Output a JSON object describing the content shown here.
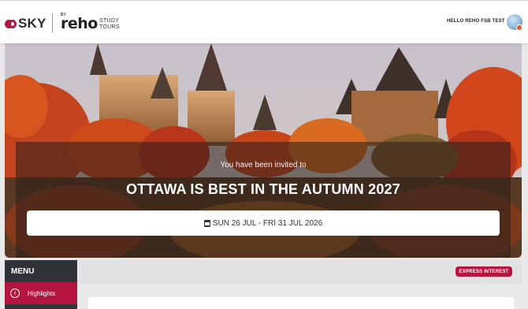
{
  "header": {
    "brand_sky": "SKY",
    "brand_by": "BY",
    "brand_reho": "reho",
    "brand_study_line1": "STUDY",
    "brand_study_line2": "TOURS",
    "greeting": "HELLO REHO FSB TEST",
    "avatar_icon": "user-avatar"
  },
  "hero": {
    "invited_text": "You have been invited to",
    "event_title": "OTTAWA IS BEST IN THE AUTUMN 2027",
    "date_icon": "calendar-icon",
    "date_range": "SUN 26 JUL - FRI 31 JUL 2026"
  },
  "menu": {
    "heading": "MENU",
    "items": [
      {
        "label": "Highlights",
        "icon": "info-icon",
        "active": true
      }
    ]
  },
  "actions": {
    "express_interest": "EXPRESS INTEREST"
  },
  "colors": {
    "brand": "#b5163f",
    "menu_dark": "#2f3237",
    "page_bg": "#e9e9ea"
  }
}
